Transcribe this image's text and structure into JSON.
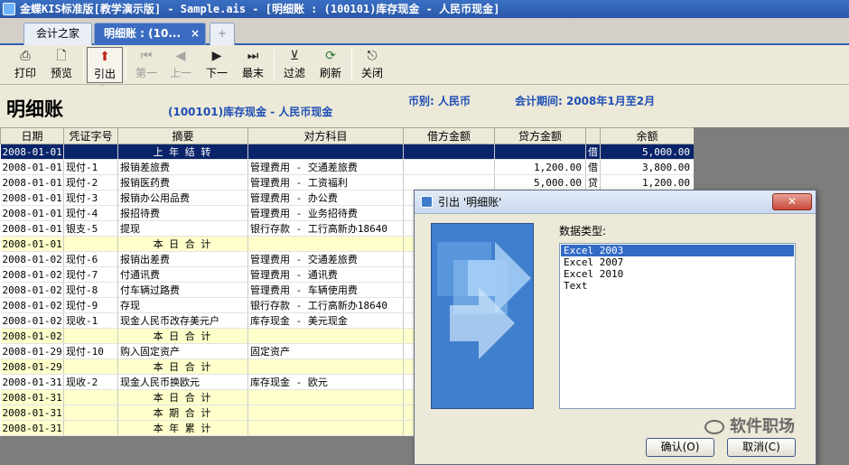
{
  "window": {
    "title": "金蝶KIS标准版[教学演示版] - Sample.ais - [明细账 : (100101)库存现金 - 人民币现金]"
  },
  "tabs": [
    {
      "label": "会计之家"
    },
    {
      "label": "明细账 : (10..."
    },
    {
      "label": "+"
    }
  ],
  "toolbar": {
    "print": "打印",
    "preview": "预览",
    "export": "引出",
    "first": "第一",
    "prev": "上一",
    "next": "下一",
    "last": "最末",
    "filter": "过滤",
    "refresh": "刷新",
    "close": "关闭"
  },
  "header": {
    "title": "明细账",
    "account": "(100101)库存现金 - 人民币现金",
    "currency": "币别: 人民币",
    "period": "会计期间: 2008年1月至2月"
  },
  "columns": [
    "日期",
    "凭证字号",
    "摘要",
    "对方科目",
    "借方金额",
    "贷方金额",
    "",
    "余额"
  ],
  "rows": [
    {
      "date": "2008-01-01",
      "voucher": "",
      "summary": "上 年 结 转",
      "account": "",
      "debit": "",
      "credit": "",
      "dir": "借",
      "balance": "5,000.00"
    },
    {
      "date": "2008-01-01",
      "voucher": "现付-1",
      "summary": "报销差旅费",
      "account": "管理费用 - 交通差旅费",
      "debit": "",
      "credit": "1,200.00",
      "dir": "借",
      "balance": "3,800.00"
    },
    {
      "date": "2008-01-01",
      "voucher": "现付-2",
      "summary": "报销医药费",
      "account": "管理费用 - 工资福利",
      "debit": "",
      "credit": "5,000.00",
      "dir": "贷",
      "balance": "1,200.00"
    },
    {
      "date": "2008-01-01",
      "voucher": "现付-3",
      "summary": "报销办公用品费",
      "account": "管理费用 - 办公费",
      "debit": "",
      "credit": "",
      "dir": "",
      "balance": ""
    },
    {
      "date": "2008-01-01",
      "voucher": "现付-4",
      "summary": "报招待费",
      "account": "管理费用 - 业务招待费",
      "debit": "",
      "credit": "",
      "dir": "",
      "balance": ""
    },
    {
      "date": "2008-01-01",
      "voucher": "银支-5",
      "summary": "提现",
      "account": "银行存款 - 工行高新办18640",
      "debit": "",
      "credit": "",
      "dir": "",
      "balance": ""
    },
    {
      "date": "2008-01-01",
      "voucher": "",
      "summary": "本 日 合 计",
      "account": "",
      "debit": "",
      "credit": "",
      "dir": "",
      "balance": ""
    },
    {
      "date": "2008-01-02",
      "voucher": "现付-6",
      "summary": "报销出差费",
      "account": "管理费用 - 交通差旅费",
      "debit": "",
      "credit": "",
      "dir": "",
      "balance": ""
    },
    {
      "date": "2008-01-02",
      "voucher": "现付-7",
      "summary": "付通讯费",
      "account": "管理费用 - 通讯费",
      "debit": "",
      "credit": "",
      "dir": "",
      "balance": ""
    },
    {
      "date": "2008-01-02",
      "voucher": "现付-8",
      "summary": "付车辆过路费",
      "account": "管理费用 - 车辆使用费",
      "debit": "",
      "credit": "",
      "dir": "",
      "balance": ""
    },
    {
      "date": "2008-01-02",
      "voucher": "现付-9",
      "summary": "存现",
      "account": "银行存款 - 工行高新办18640",
      "debit": "",
      "credit": "",
      "dir": "",
      "balance": ""
    },
    {
      "date": "2008-01-02",
      "voucher": "现收-1",
      "summary": "现金人民币改存美元户",
      "account": "库存现金 - 美元现金",
      "debit": "",
      "credit": "",
      "dir": "",
      "balance": ""
    },
    {
      "date": "2008-01-02",
      "voucher": "",
      "summary": "本 日 合 计",
      "account": "",
      "debit": "",
      "credit": "",
      "dir": "",
      "balance": ""
    },
    {
      "date": "2008-01-29",
      "voucher": "现付-10",
      "summary": "购入固定资产",
      "account": "固定资产",
      "debit": "",
      "credit": "",
      "dir": "",
      "balance": ""
    },
    {
      "date": "2008-01-29",
      "voucher": "",
      "summary": "本 日 合 计",
      "account": "",
      "debit": "",
      "credit": "",
      "dir": "",
      "balance": ""
    },
    {
      "date": "2008-01-31",
      "voucher": "现收-2",
      "summary": "现金人民币换欧元",
      "account": "库存现金 - 欧元",
      "debit": "",
      "credit": "",
      "dir": "",
      "balance": ""
    },
    {
      "date": "2008-01-31",
      "voucher": "",
      "summary": "本 日 合 计",
      "account": "",
      "debit": "",
      "credit": "",
      "dir": "",
      "balance": ""
    },
    {
      "date": "2008-01-31",
      "voucher": "",
      "summary": "本 期 合 计",
      "account": "",
      "debit": "",
      "credit": "",
      "dir": "",
      "balance": ""
    },
    {
      "date": "2008-01-31",
      "voucher": "",
      "summary": "本 年 累 计",
      "account": "",
      "debit": "",
      "credit": "",
      "dir": "",
      "balance": ""
    }
  ],
  "dialog": {
    "title": "引出 '明细账'",
    "close": "✕",
    "type_label": "数据类型:",
    "options": [
      "Excel 2003",
      "Excel 2007",
      "Excel 2010",
      "Text"
    ],
    "selected_index": 0,
    "ok": "确认(O)",
    "cancel": "取消(C)"
  },
  "watermark": "软件职场"
}
